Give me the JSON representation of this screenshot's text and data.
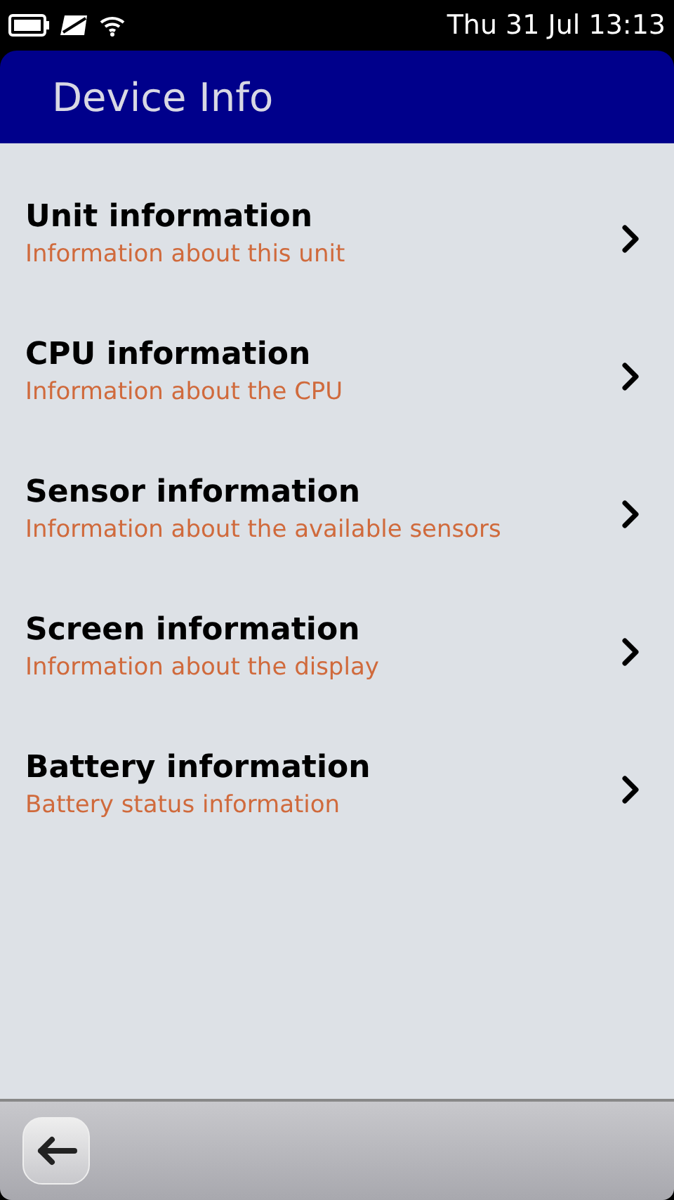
{
  "status_bar": {
    "time": "Thu 31 Jul 13:13"
  },
  "header": {
    "title": "Device Info"
  },
  "items": [
    {
      "title": "Unit information",
      "subtitle": "Information about this unit"
    },
    {
      "title": "CPU information",
      "subtitle": "Information about the CPU"
    },
    {
      "title": "Sensor information",
      "subtitle": "Information about the available sensors"
    },
    {
      "title": "Screen information",
      "subtitle": "Information about the display"
    },
    {
      "title": "Battery information",
      "subtitle": "Battery status information"
    }
  ]
}
